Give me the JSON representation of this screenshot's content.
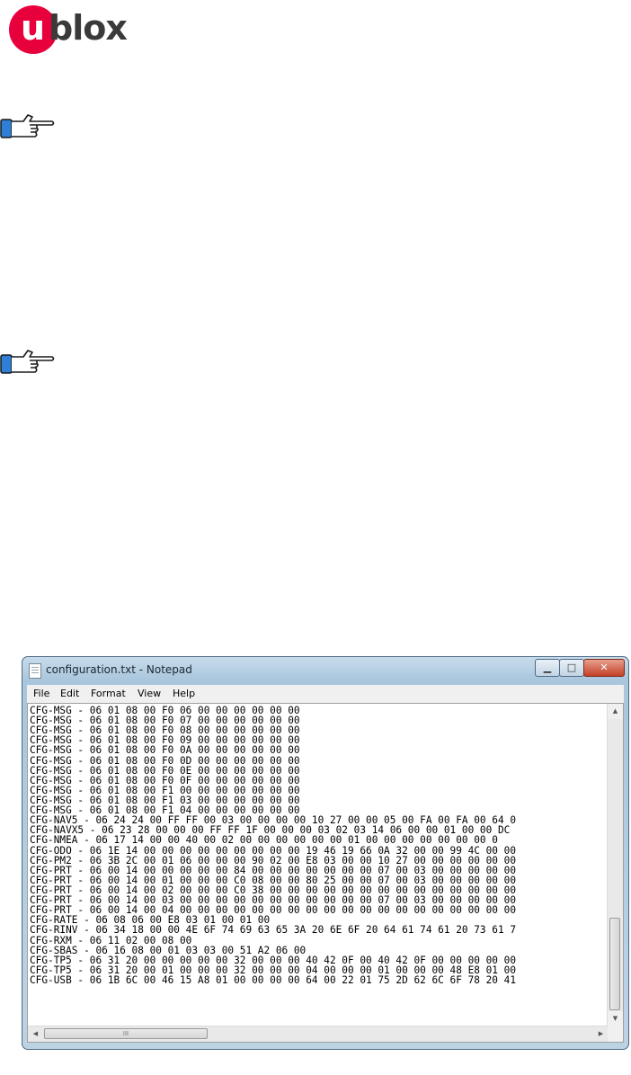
{
  "logo": {
    "mark": "u",
    "text": "blox"
  },
  "icons": {
    "hand": "pointing-hand-icon",
    "app": "notepad-icon"
  },
  "window": {
    "title": "configuration.txt - Notepad",
    "controls": {
      "minimize": "▁",
      "maximize": "□",
      "close": "✕"
    }
  },
  "menu": [
    "File",
    "Edit",
    "Format",
    "View",
    "Help"
  ],
  "scroll": {
    "up": "▲",
    "down": "▼",
    "left": "◀",
    "right": "▶",
    "grip": "III"
  },
  "lines": [
    "CFG-MSG - 06 01 08 00 F0 06 00 00 00 00 00 00",
    "CFG-MSG - 06 01 08 00 F0 07 00 00 00 00 00 00",
    "CFG-MSG - 06 01 08 00 F0 08 00 00 00 00 00 00",
    "CFG-MSG - 06 01 08 00 F0 09 00 00 00 00 00 00",
    "CFG-MSG - 06 01 08 00 F0 0A 00 00 00 00 00 00",
    "CFG-MSG - 06 01 08 00 F0 0D 00 00 00 00 00 00",
    "CFG-MSG - 06 01 08 00 F0 0E 00 00 00 00 00 00",
    "CFG-MSG - 06 01 08 00 F0 0F 00 00 00 00 00 00",
    "CFG-MSG - 06 01 08 00 F1 00 00 00 00 00 00 00",
    "CFG-MSG - 06 01 08 00 F1 03 00 00 00 00 00 00",
    "CFG-MSG - 06 01 08 00 F1 04 00 00 00 00 00 00",
    "CFG-NAV5 - 06 24 24 00 FF FF 00 03 00 00 00 00 10 27 00 00 05 00 FA 00 FA 00 64 0",
    "CFG-NAVX5 - 06 23 28 00 00 00 FF FF 1F 00 00 00 03 02 03 14 06 00 00 01 00 00 DC",
    "CFG-NMEA - 06 17 14 00 00 40 00 02 00 00 00 00 00 00 01 00 00 00 00 00 00 00 0",
    "CFG-ODO - 06 1E 14 00 00 00 00 00 00 00 00 00 19 46 19 66 0A 32 00 00 99 4C 00 00",
    "CFG-PM2 - 06 3B 2C 00 01 06 00 00 00 90 02 00 E8 03 00 00 10 27 00 00 00 00 00 00",
    "CFG-PRT - 06 00 14 00 00 00 00 00 84 00 00 00 00 00 00 00 07 00 03 00 00 00 00 00",
    "CFG-PRT - 06 00 14 00 01 00 00 00 C0 08 00 00 80 25 00 00 07 00 03 00 00 00 00 00",
    "CFG-PRT - 06 00 14 00 02 00 00 00 C0 38 00 00 00 00 00 00 00 00 00 00 00 00 00 00",
    "CFG-PRT - 06 00 14 00 03 00 00 00 00 00 00 00 00 00 00 00 07 00 03 00 00 00 00 00",
    "CFG-PRT - 06 00 14 00 04 00 00 00 00 00 00 00 00 00 00 00 00 00 00 00 00 00 00 00",
    "CFG-RATE - 06 08 06 00 E8 03 01 00 01 00",
    "CFG-RINV - 06 34 18 00 00 4E 6F 74 69 63 65 3A 20 6E 6F 20 64 61 74 61 20 73 61 7",
    "CFG-RXM - 06 11 02 00 08 00",
    "CFG-SBAS - 06 16 08 00 01 03 03 00 51 A2 06 00",
    "CFG-TP5 - 06 31 20 00 00 00 00 00 32 00 00 00 40 42 0F 00 40 42 0F 00 00 00 00 00",
    "CFG-TP5 - 06 31 20 00 01 00 00 00 32 00 00 00 04 00 00 00 01 00 00 00 48 E8 01 00",
    "CFG-USB - 06 1B 6C 00 46 15 A8 01 00 00 00 00 64 00 22 01 75 2D 62 6C 6F 78 20 41"
  ]
}
